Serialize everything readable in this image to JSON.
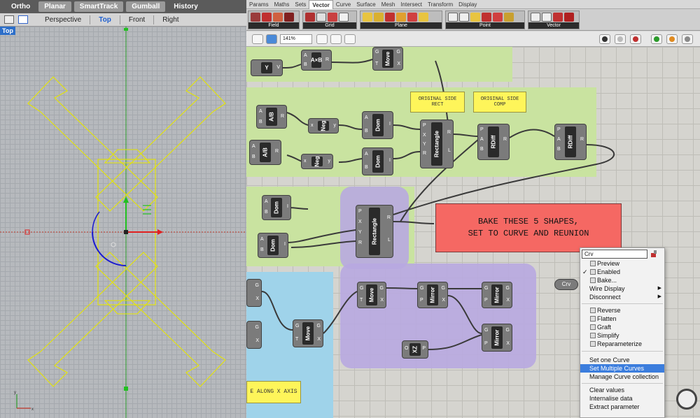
{
  "rhino": {
    "modes": [
      "Ortho",
      "Planar",
      "SmartTrack",
      "Gumball",
      "History"
    ],
    "active_modes": [
      "Planar",
      "SmartTrack",
      "Gumball"
    ],
    "view_tabs": [
      "Perspective",
      "Top",
      "Front",
      "Right"
    ],
    "active_view": "Top",
    "viewport_label": "Top"
  },
  "grasshopper": {
    "menu_tabs": [
      "Params",
      "Maths",
      "Sets",
      "Vector",
      "Curve",
      "Surface",
      "Mesh",
      "Intersect",
      "Transform",
      "Display"
    ],
    "active_tab": "Vector",
    "ribbon_groups": [
      "Field",
      "Grid",
      "Plane",
      "Point",
      "Vector"
    ],
    "zoom": "141%",
    "panels": {
      "original_side_rect": "ORIGINAL SIDE RECT",
      "original_side_comp": "ORIGINAL SIDE COMP",
      "bake_line1": "BAKE THESE 5 SHAPES,",
      "bake_line2": "SET TO CURVE AND REUNION",
      "along_x": "E ALONG X AXIS"
    },
    "components": {
      "y": "Y",
      "axb": "A×B",
      "move": "Move",
      "ab": "A/B",
      "neg": "Neg",
      "dom": "Dom",
      "rectangle": "Rectangle",
      "rdiff": "RDiff",
      "mirror": "Mirror",
      "xz": "XZ",
      "crv": "Crv"
    },
    "context_menu": {
      "search_value": "Crv",
      "items": [
        {
          "label": "Preview",
          "checked": false,
          "icon": true
        },
        {
          "label": "Enabled",
          "checked": true,
          "icon": true
        },
        {
          "label": "Bake...",
          "checked": false,
          "icon": true
        },
        {
          "label": "Wire Display",
          "submenu": true
        },
        {
          "label": "Disconnect",
          "submenu": true
        },
        {
          "label": "Reverse",
          "icon": true
        },
        {
          "label": "Flatten",
          "icon": true
        },
        {
          "label": "Graft",
          "icon": true
        },
        {
          "label": "Simplify",
          "icon": true
        },
        {
          "label": "Reparameterize",
          "icon": true
        },
        {
          "label": "Set one Curve"
        },
        {
          "label": "Set Multiple Curves",
          "highlighted": true
        },
        {
          "label": "Manage Curve collection"
        },
        {
          "label": "Clear values"
        },
        {
          "label": "Internalise data"
        },
        {
          "label": "Extract parameter"
        }
      ]
    }
  }
}
